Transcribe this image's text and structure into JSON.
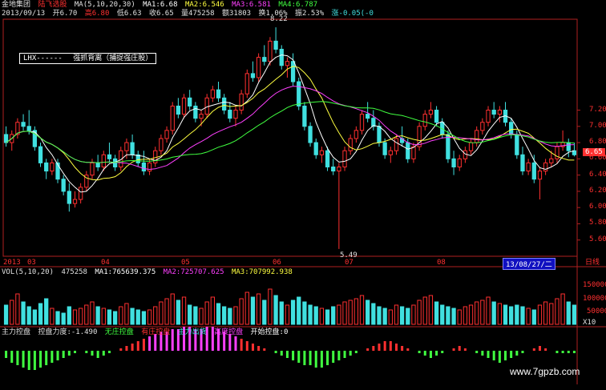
{
  "header": {
    "app": "金地集团",
    "stock": "陆飞选股",
    "ma_params": "MA(5,10,20,30)",
    "ma1": "MA1:6.68",
    "ma2": "MA2:6.546",
    "ma3": "MA3:6.581",
    "ma4": "MA4:6.787",
    "date": "2013/09/13",
    "open": "开6.70",
    "high": "高6.80",
    "low": "低6.63",
    "close": "收6.65",
    "volume": "量475258",
    "amount": "额31803",
    "turnover": "换1.06%",
    "amplitude": "振2.53%",
    "change": "涨-0.05(-0"
  },
  "legend": {
    "series": "LHX------",
    "text": "强抓背离（捕捉强庄股）"
  },
  "price_axis": {
    "ticks": [
      "7.20",
      "7.00",
      "6.80",
      "6.60",
      "6.40",
      "6.20",
      "6.00",
      "5.80",
      "5.60"
    ],
    "current": "6.65",
    "peak_label": "8.22",
    "low_label": "5.49"
  },
  "time_axis": {
    "labels": [
      "2013",
      "03",
      "04",
      "05",
      "06",
      "07",
      "08"
    ],
    "current_date": "13/08/27/二",
    "period": "日线"
  },
  "volume_panel": {
    "title": "VOL(5,10,20)",
    "vol": "475258",
    "ma1": "MA1:765639.375",
    "ma2": "MA2:725707.625",
    "ma3": "MA3:707992.938",
    "ticks": [
      "150000",
      "100000",
      "50000"
    ],
    "unit": "X10"
  },
  "indicator_panel": {
    "name": "主力控盘",
    "force": "控盘力度:-1.490",
    "s1": "无庄控盘",
    "s2": "有庄控盘",
    "s3": "主力出货",
    "s4": "高度控盘",
    "s5": "开始控盘:0"
  },
  "watermark": "www.7gpzb.com",
  "colors": {
    "up": "#ff3030",
    "down": "#40e0e0",
    "bg": "#000000",
    "axis": "#b02020"
  },
  "chart_data": {
    "type": "candlestick",
    "ylim": [
      5.4,
      8.3
    ],
    "ohlc": [
      [
        6.9,
        7.0,
        6.75,
        6.8
      ],
      [
        6.8,
        6.95,
        6.7,
        6.9
      ],
      [
        6.9,
        7.1,
        6.85,
        7.05
      ],
      [
        7.05,
        7.15,
        6.95,
        7.0
      ],
      [
        7.0,
        7.2,
        6.9,
        6.95
      ],
      [
        6.95,
        7.0,
        6.7,
        6.75
      ],
      [
        6.75,
        6.8,
        6.5,
        6.55
      ],
      [
        6.55,
        6.6,
        6.35,
        6.45
      ],
      [
        6.45,
        6.6,
        6.4,
        6.55
      ],
      [
        6.55,
        6.6,
        6.3,
        6.35
      ],
      [
        6.35,
        6.4,
        6.15,
        6.2
      ],
      [
        6.2,
        6.3,
        5.95,
        6.05
      ],
      [
        6.05,
        6.2,
        6.0,
        6.1
      ],
      [
        6.1,
        6.3,
        6.05,
        6.25
      ],
      [
        6.25,
        6.45,
        6.2,
        6.4
      ],
      [
        6.4,
        6.6,
        6.35,
        6.55
      ],
      [
        6.55,
        6.65,
        6.45,
        6.5
      ],
      [
        6.5,
        6.7,
        6.45,
        6.65
      ],
      [
        6.65,
        6.8,
        6.55,
        6.6
      ],
      [
        6.6,
        6.65,
        6.45,
        6.5
      ],
      [
        6.5,
        6.75,
        6.45,
        6.7
      ],
      [
        6.7,
        6.85,
        6.6,
        6.8
      ],
      [
        6.8,
        6.9,
        6.6,
        6.65
      ],
      [
        6.65,
        6.7,
        6.5,
        6.55
      ],
      [
        6.55,
        6.7,
        6.4,
        6.45
      ],
      [
        6.45,
        6.6,
        6.4,
        6.55
      ],
      [
        6.55,
        6.75,
        6.5,
        6.7
      ],
      [
        6.7,
        6.9,
        6.65,
        6.85
      ],
      [
        6.85,
        7.0,
        6.8,
        6.95
      ],
      [
        6.95,
        7.3,
        6.9,
        7.25
      ],
      [
        7.25,
        7.35,
        7.1,
        7.15
      ],
      [
        7.15,
        7.4,
        7.1,
        7.35
      ],
      [
        7.35,
        7.45,
        7.2,
        7.25
      ],
      [
        7.25,
        7.3,
        7.05,
        7.1
      ],
      [
        7.1,
        7.2,
        7.0,
        7.15
      ],
      [
        7.15,
        7.4,
        7.1,
        7.35
      ],
      [
        7.35,
        7.5,
        7.3,
        7.45
      ],
      [
        7.45,
        7.55,
        7.3,
        7.35
      ],
      [
        7.35,
        7.4,
        7.15,
        7.2
      ],
      [
        7.2,
        7.3,
        7.05,
        7.1
      ],
      [
        7.1,
        7.25,
        7.0,
        7.2
      ],
      [
        7.2,
        7.45,
        7.15,
        7.4
      ],
      [
        7.4,
        7.7,
        7.35,
        7.65
      ],
      [
        7.65,
        7.8,
        7.55,
        7.6
      ],
      [
        7.6,
        7.9,
        7.55,
        7.85
      ],
      [
        7.85,
        8.0,
        7.75,
        7.8
      ],
      [
        7.8,
        8.1,
        7.75,
        8.05
      ],
      [
        8.05,
        8.22,
        7.9,
        7.95
      ],
      [
        7.95,
        8.0,
        7.7,
        7.75
      ],
      [
        7.75,
        7.85,
        7.6,
        7.8
      ],
      [
        7.8,
        7.9,
        7.5,
        7.55
      ],
      [
        7.55,
        7.6,
        7.2,
        7.25
      ],
      [
        7.25,
        7.3,
        6.95,
        7.0
      ],
      [
        7.0,
        7.05,
        6.75,
        6.8
      ],
      [
        6.8,
        6.85,
        6.6,
        6.65
      ],
      [
        6.65,
        6.75,
        6.55,
        6.7
      ],
      [
        6.7,
        6.75,
        6.45,
        6.5
      ],
      [
        6.5,
        6.6,
        6.4,
        6.45
      ],
      [
        6.45,
        6.55,
        5.49,
        6.5
      ],
      [
        6.5,
        6.75,
        6.45,
        6.7
      ],
      [
        6.7,
        6.9,
        6.65,
        6.85
      ],
      [
        6.85,
        7.0,
        6.8,
        6.95
      ],
      [
        6.95,
        7.2,
        6.9,
        7.15
      ],
      [
        7.15,
        7.3,
        7.05,
        7.1
      ],
      [
        7.1,
        7.2,
        6.95,
        7.0
      ],
      [
        7.0,
        7.05,
        6.75,
        6.8
      ],
      [
        6.8,
        6.85,
        6.6,
        6.65
      ],
      [
        6.65,
        6.75,
        6.55,
        6.7
      ],
      [
        6.7,
        6.9,
        6.65,
        6.85
      ],
      [
        6.85,
        7.0,
        6.75,
        6.8
      ],
      [
        6.8,
        6.85,
        6.55,
        6.6
      ],
      [
        6.6,
        6.8,
        6.55,
        6.75
      ],
      [
        6.75,
        7.05,
        6.7,
        7.0
      ],
      [
        7.0,
        7.2,
        6.95,
        7.15
      ],
      [
        7.15,
        7.3,
        7.1,
        7.2
      ],
      [
        7.2,
        7.25,
        7.0,
        7.05
      ],
      [
        7.05,
        7.1,
        6.85,
        6.9
      ],
      [
        6.9,
        6.95,
        6.55,
        6.6
      ],
      [
        6.6,
        6.7,
        6.4,
        6.5
      ],
      [
        6.5,
        6.65,
        6.45,
        6.6
      ],
      [
        6.6,
        6.75,
        6.55,
        6.7
      ],
      [
        6.7,
        6.85,
        6.65,
        6.8
      ],
      [
        6.8,
        7.0,
        6.75,
        6.95
      ],
      [
        6.95,
        7.1,
        6.9,
        7.05
      ],
      [
        7.05,
        7.25,
        7.0,
        7.2
      ],
      [
        7.2,
        7.3,
        7.1,
        7.15
      ],
      [
        7.15,
        7.25,
        7.05,
        7.2
      ],
      [
        7.2,
        7.3,
        7.0,
        7.05
      ],
      [
        7.05,
        7.1,
        6.85,
        6.9
      ],
      [
        6.9,
        6.95,
        6.6,
        6.65
      ],
      [
        6.65,
        6.75,
        6.4,
        6.45
      ],
      [
        6.45,
        6.6,
        6.4,
        6.55
      ],
      [
        6.55,
        6.65,
        6.3,
        6.35
      ],
      [
        6.35,
        6.5,
        6.1,
        6.45
      ],
      [
        6.45,
        6.6,
        6.4,
        6.55
      ],
      [
        6.55,
        6.7,
        6.5,
        6.6
      ],
      [
        6.6,
        6.8,
        6.55,
        6.75
      ],
      [
        6.75,
        6.95,
        6.7,
        6.8
      ],
      [
        6.8,
        6.85,
        6.62,
        6.7
      ],
      [
        6.7,
        6.8,
        6.63,
        6.65
      ]
    ],
    "volume": [
      60,
      75,
      95,
      70,
      55,
      45,
      65,
      80,
      50,
      40,
      35,
      55,
      45,
      50,
      60,
      70,
      55,
      50,
      45,
      40,
      55,
      65,
      50,
      45,
      40,
      45,
      55,
      70,
      80,
      95,
      75,
      85,
      60,
      55,
      50,
      70,
      85,
      65,
      55,
      50,
      55,
      80,
      100,
      85,
      95,
      75,
      110,
      90,
      70,
      60,
      75,
      85,
      70,
      60,
      55,
      50,
      45,
      55,
      60,
      70,
      75,
      80,
      90,
      75,
      65,
      55,
      50,
      45,
      60,
      55,
      50,
      60,
      75,
      85,
      90,
      70,
      60,
      55,
      50,
      45,
      55,
      60,
      70,
      75,
      85,
      70,
      65,
      60,
      55,
      60,
      55,
      50,
      45,
      60,
      70,
      65,
      80,
      95,
      70,
      60
    ],
    "indicator": [
      -3,
      -5,
      -6,
      -7,
      -8,
      -8,
      -7,
      -6,
      -5,
      -4,
      -3,
      -2,
      -1,
      0,
      -1,
      -2,
      -3,
      -2,
      -1,
      0,
      1,
      2,
      3,
      4,
      5,
      6,
      7,
      8,
      8,
      9,
      9,
      10,
      10,
      9,
      9,
      10,
      10,
      9,
      8,
      7,
      6,
      5,
      4,
      3,
      2,
      1,
      0,
      -1,
      -2,
      -3,
      -4,
      -5,
      -6,
      -6,
      -7,
      -7,
      -6,
      -5,
      -4,
      -3,
      -2,
      -1,
      0,
      1,
      2,
      3,
      4,
      4,
      3,
      2,
      1,
      0,
      -1,
      -2,
      -3,
      -2,
      -1,
      0,
      1,
      2,
      1,
      0,
      -1,
      -2,
      -3,
      -4,
      -5,
      -4,
      -3,
      -2,
      -1,
      0,
      1,
      2,
      1,
      0,
      -1,
      -1,
      -1,
      -1
    ]
  }
}
